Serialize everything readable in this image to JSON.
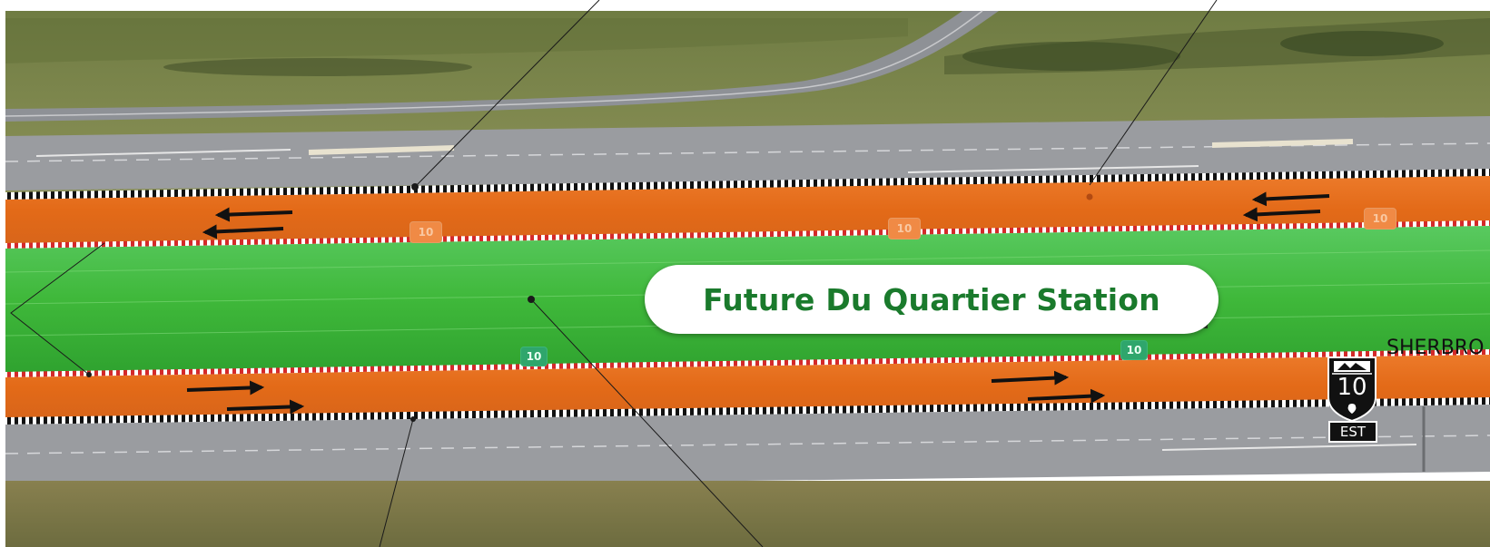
{
  "station": {
    "label": "Future Du Quartier Station"
  },
  "street": {
    "label": "SHERBRO"
  },
  "route_markers": [
    {
      "number": "10",
      "style": "orange"
    },
    {
      "number": "10",
      "style": "orange"
    },
    {
      "number": "10",
      "style": "orange"
    },
    {
      "number": "10",
      "style": "green"
    },
    {
      "number": "10",
      "style": "green"
    }
  ],
  "highway_shield": {
    "number": "10",
    "direction": "EST"
  },
  "colors": {
    "guideway_lane": "#e9731f",
    "center_median": "#3fb83a",
    "grass": "#7d8a4e",
    "road": "#9a9ca0",
    "station_text": "#1a7a2c",
    "boundary_red": "#d42a2a",
    "boundary_black": "#111111"
  },
  "icons": [
    "arrow-left-icon",
    "arrow-right-icon",
    "highway-shield-icon"
  ]
}
